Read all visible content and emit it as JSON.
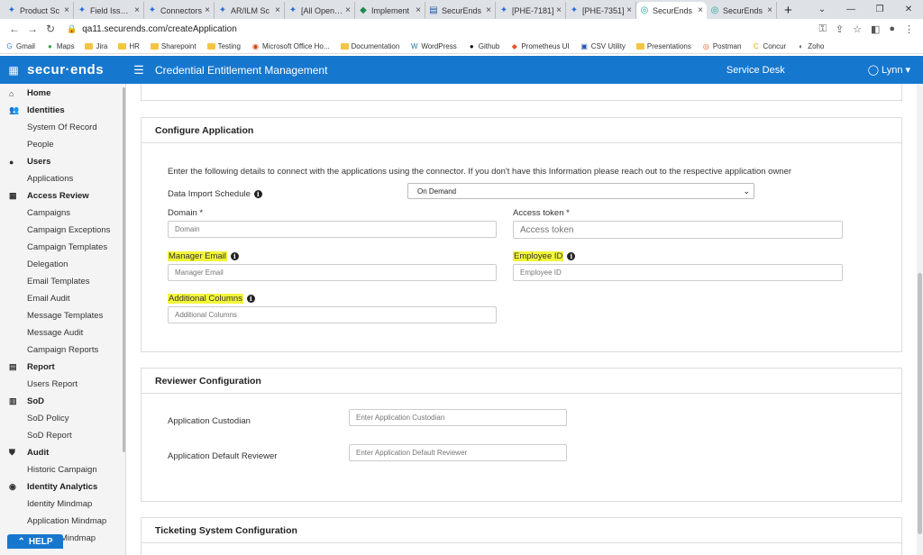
{
  "browser": {
    "tabs": [
      {
        "label": "Product Sc",
        "icon": "confluence-icon",
        "active": false
      },
      {
        "label": "Field Issues",
        "icon": "confluence-icon",
        "active": false
      },
      {
        "label": "Connectors",
        "icon": "confluence-icon",
        "active": false
      },
      {
        "label": "AR/ILM Sc",
        "icon": "confluence-icon",
        "active": false
      },
      {
        "label": "[All Open Du",
        "icon": "confluence-icon",
        "active": false
      },
      {
        "label": "Implement",
        "icon": "green-icon",
        "active": false
      },
      {
        "label": "SecurEnds",
        "icon": "doc-icon",
        "active": false
      },
      {
        "label": "[PHE-7181]",
        "icon": "confluence-icon",
        "active": false
      },
      {
        "label": "[PHE-7351]",
        "icon": "confluence-icon",
        "active": false
      },
      {
        "label": "SecurEnds",
        "icon": "securends-icon",
        "active": true
      },
      {
        "label": "SecurEnds",
        "icon": "securends-icon",
        "active": false
      }
    ],
    "url": "qa11.securends.com/createApplication",
    "bookmarks": [
      "Gmail",
      "Maps",
      "Jira",
      "HR",
      "Sharepoint",
      "Testing",
      "Microsoft Office Ho...",
      "Documentation",
      "WordPress",
      "Github",
      "Prometheus UI",
      "CSV Utility",
      "Presentations",
      "Postman",
      "Concur",
      "Zoho"
    ]
  },
  "app": {
    "logo": "secur·ends",
    "title": "Credential Entitlement Management",
    "service_desk": "Service Desk",
    "user": "Lynn",
    "accent": "#1677cf"
  },
  "sidebar": {
    "items": [
      {
        "label": "Home",
        "type": "section",
        "icon": "home-icon"
      },
      {
        "label": "Identities",
        "type": "section",
        "icon": "identities-icon"
      },
      {
        "label": "System Of Record",
        "type": "sub"
      },
      {
        "label": "People",
        "type": "sub"
      },
      {
        "label": "Users",
        "type": "section",
        "icon": "user-icon"
      },
      {
        "label": "Applications",
        "type": "sub"
      },
      {
        "label": "Access Review",
        "type": "section",
        "icon": "grid-icon"
      },
      {
        "label": "Campaigns",
        "type": "sub"
      },
      {
        "label": "Campaign Exceptions",
        "type": "sub"
      },
      {
        "label": "Campaign Templates",
        "type": "sub"
      },
      {
        "label": "Delegation",
        "type": "sub"
      },
      {
        "label": "Email Templates",
        "type": "sub"
      },
      {
        "label": "Email Audit",
        "type": "sub"
      },
      {
        "label": "Message Templates",
        "type": "sub"
      },
      {
        "label": "Message Audit",
        "type": "sub"
      },
      {
        "label": "Campaign Reports",
        "type": "sub"
      },
      {
        "label": "Report",
        "type": "section",
        "icon": "report-icon"
      },
      {
        "label": "Users Report",
        "type": "sub"
      },
      {
        "label": "SoD",
        "type": "section",
        "icon": "sod-icon"
      },
      {
        "label": "SoD Policy",
        "type": "sub"
      },
      {
        "label": "SoD Report",
        "type": "sub"
      },
      {
        "label": "Audit",
        "type": "section",
        "icon": "shield-icon"
      },
      {
        "label": "Historic Campaign",
        "type": "sub"
      },
      {
        "label": "Identity Analytics",
        "type": "section",
        "icon": "analytics-icon"
      },
      {
        "label": "Identity Mindmap",
        "type": "sub"
      },
      {
        "label": "Application Mindmap",
        "type": "sub"
      },
      {
        "label": "Account Mindmap",
        "type": "sub"
      }
    ],
    "help": "HELP"
  },
  "configure": {
    "heading": "Configure Application",
    "intro": "Enter the following details to connect with the applications using the connector. If you don't have this Information please reach out to the respective application owner",
    "schedule_label": "Data Import Schedule",
    "schedule_value": "On Demand",
    "domain_label": "Domain *",
    "domain_placeholder": "Domain",
    "token_label": "Access token *",
    "token_placeholder": "Access token",
    "manager_label": "Manager Email",
    "manager_placeholder": "Manager Email",
    "employee_label": "Employee ID",
    "employee_placeholder": "Employee ID",
    "additional_label": "Additional Columns",
    "additional_placeholder": "Additional Columns"
  },
  "reviewer": {
    "heading": "Reviewer Configuration",
    "custodian_label": "Application Custodian",
    "custodian_placeholder": "Enter Application Custodian",
    "default_label": "Application Default Reviewer",
    "default_placeholder": "Enter Application Default Reviewer"
  },
  "ticketing": {
    "heading": "Ticketing System Configuration"
  }
}
